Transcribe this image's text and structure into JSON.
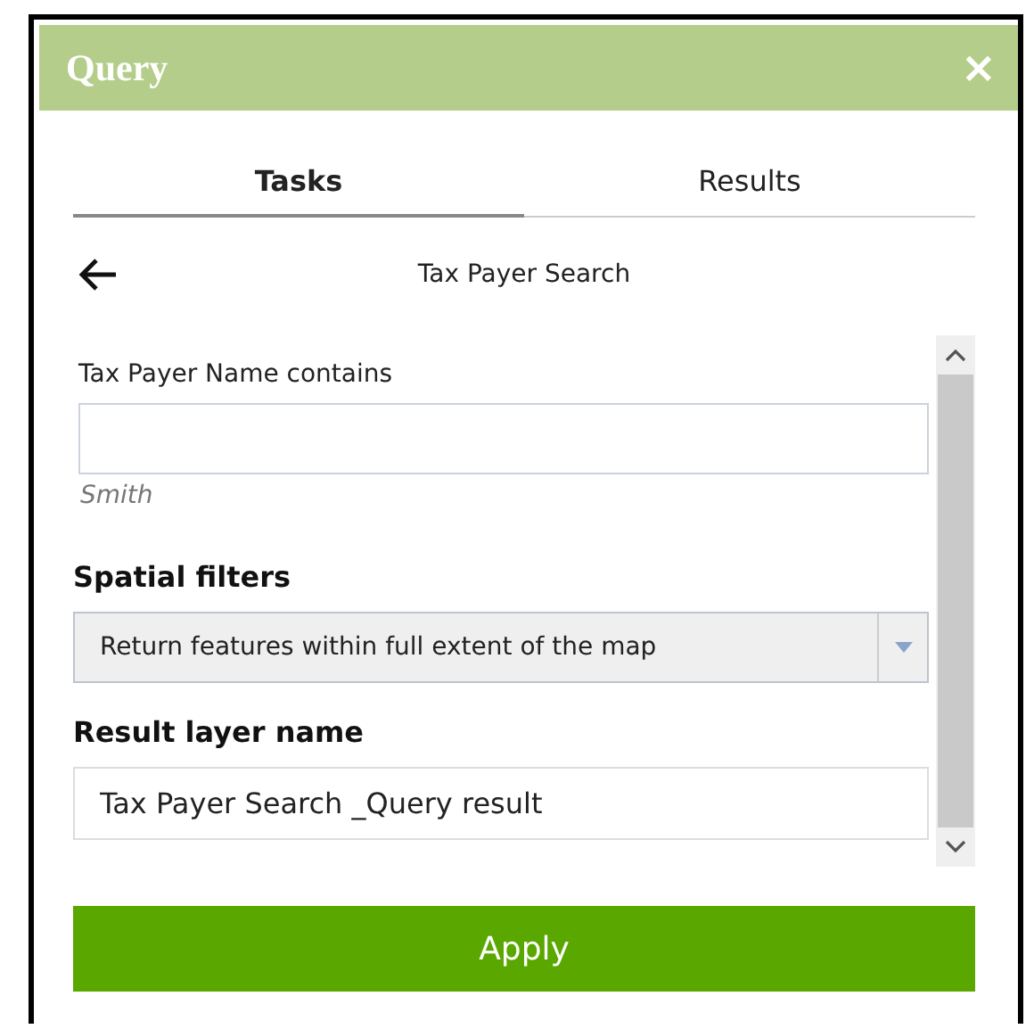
{
  "window": {
    "title": "Query",
    "close": "×"
  },
  "tabs": [
    {
      "label": "Tasks",
      "selected": true
    },
    {
      "label": "Results",
      "selected": false
    }
  ],
  "back": {
    "title": "Tax Payer Search"
  },
  "fields": [
    {
      "kind": "text",
      "label": "Tax Payer Name contains",
      "hint": "Smith"
    },
    {
      "kind": "select",
      "label": "Spatial filters",
      "value": "Return features within full extent of the map"
    },
    {
      "kind": "input",
      "label": "Result layer name",
      "value": "Tax Payer Search _Query result"
    }
  ],
  "apply": "Apply"
}
